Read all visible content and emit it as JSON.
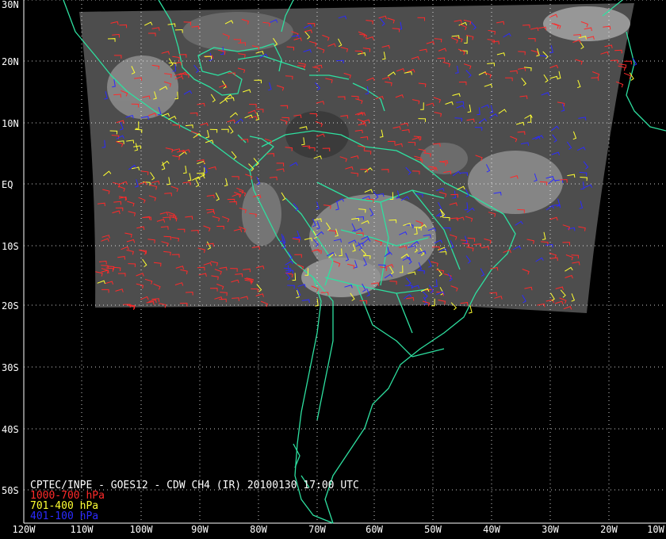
{
  "title": "CPTEC/INPE - GOES12 - CDW CH4 (IR) 20100130 17:00 UTC",
  "legend": [
    {
      "label": "1000-700 hPa",
      "color": "#ff2a2a"
    },
    {
      "label": "701-400 hPa",
      "color": "#ffff30"
    },
    {
      "label": "401-100 hPa",
      "color": "#2b2bff"
    }
  ],
  "lat_labels": [
    "30N",
    "20N",
    "10N",
    "EQ",
    "10S",
    "20S",
    "30S",
    "40S",
    "50S"
  ],
  "lon_labels": [
    "120W",
    "110W",
    "100W",
    "90W",
    "80W",
    "70W",
    "60W",
    "50W",
    "40W",
    "30W",
    "20W",
    "10W"
  ],
  "colors": {
    "coastline": "#2ee0a0",
    "grid": "#ffffff",
    "background": "#000000",
    "imagery": "#505050"
  }
}
